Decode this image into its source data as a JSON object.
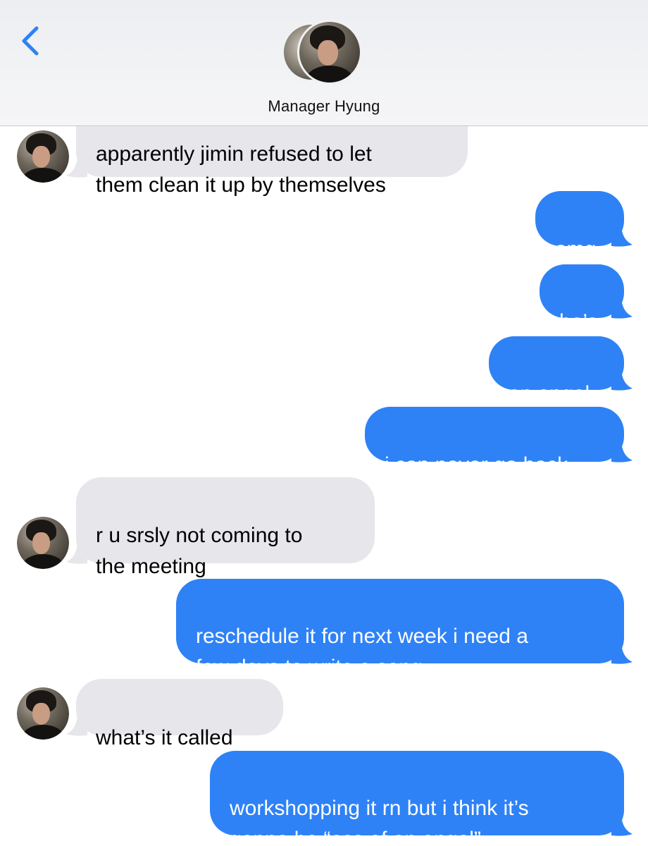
{
  "header": {
    "contact_name": "Manager Hyung",
    "back_icon": "chevron-left-icon",
    "accent_color": "#2e82f6"
  },
  "messages": [
    {
      "direction": "received",
      "text": "apparently jimin refused to let\nthem clean it up by themselves",
      "with_avatar": true
    },
    {
      "direction": "sent",
      "text": "omg"
    },
    {
      "direction": "sent",
      "text": "he’s"
    },
    {
      "direction": "sent",
      "text": "an angel"
    },
    {
      "direction": "sent",
      "text": "i can never go back"
    },
    {
      "direction": "received",
      "text": "r u srsly not coming to\nthe meeting",
      "with_avatar": true
    },
    {
      "direction": "sent",
      "text": "reschedule it for next week i need a\nfew days to write a song"
    },
    {
      "direction": "received",
      "text": "what’s it called",
      "with_avatar": true
    },
    {
      "direction": "sent",
      "text": "workshopping it rn but i think it’s\ngonna be “ass of an angel”"
    }
  ],
  "colors": {
    "sent_bubble": "#2e82f6",
    "received_bubble": "#e6e6eb"
  }
}
